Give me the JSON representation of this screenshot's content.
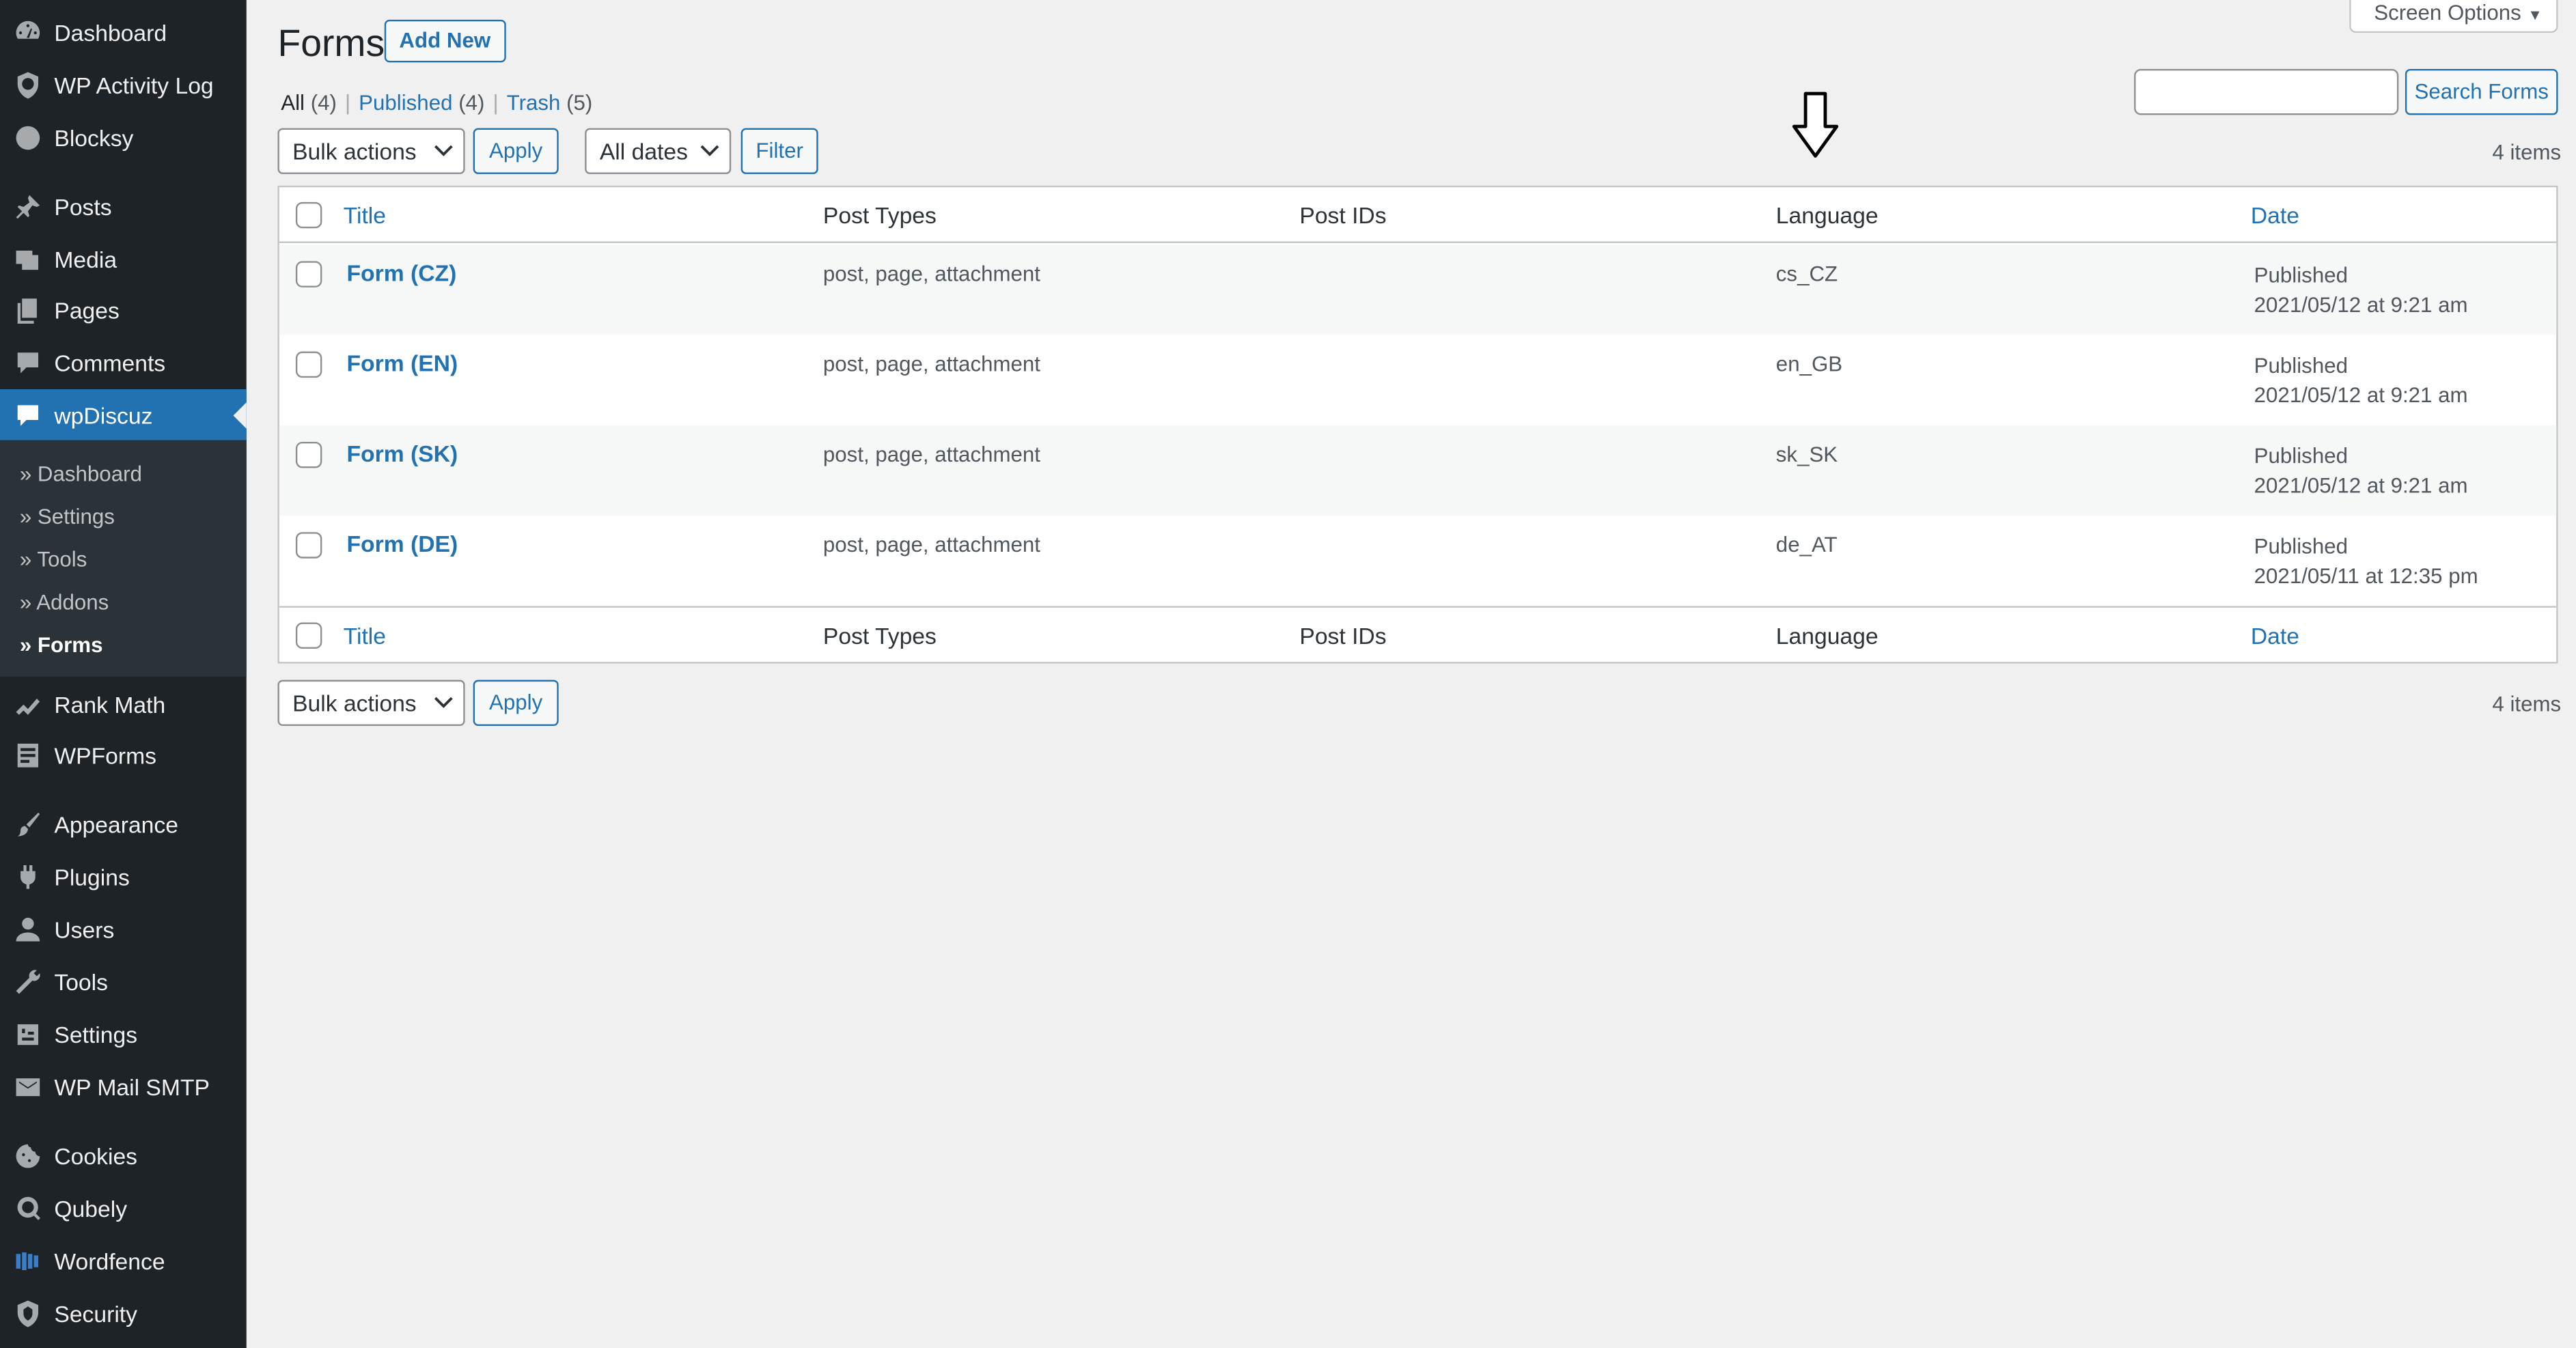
{
  "sidebar": {
    "items": [
      {
        "label": "Dashboard",
        "icon": "dashboard-icon"
      },
      {
        "label": "WP Activity Log",
        "icon": "activity-log-icon"
      },
      {
        "label": "Blocksy",
        "icon": "blocksy-icon"
      },
      {
        "label": "Posts",
        "icon": "pin-icon"
      },
      {
        "label": "Media",
        "icon": "media-icon"
      },
      {
        "label": "Pages",
        "icon": "pages-icon"
      },
      {
        "label": "Comments",
        "icon": "comment-icon"
      },
      {
        "label": "wpDiscuz",
        "icon": "comment-icon"
      },
      {
        "label": "Rank Math",
        "icon": "rank-math-icon"
      },
      {
        "label": "WPForms",
        "icon": "forms-icon"
      },
      {
        "label": "Appearance",
        "icon": "paintbrush-icon"
      },
      {
        "label": "Plugins",
        "icon": "plugin-icon"
      },
      {
        "label": "Users",
        "icon": "user-icon"
      },
      {
        "label": "Tools",
        "icon": "wrench-icon"
      },
      {
        "label": "Settings",
        "icon": "settings-icon"
      },
      {
        "label": "WP Mail SMTP",
        "icon": "mail-icon"
      },
      {
        "label": "Cookies",
        "icon": "cookie-icon"
      },
      {
        "label": "Qubely",
        "icon": "qubely-icon"
      },
      {
        "label": "Wordfence",
        "icon": "wordfence-icon"
      },
      {
        "label": "Security",
        "icon": "shield-icon"
      }
    ],
    "submenu": [
      {
        "label": "» Dashboard"
      },
      {
        "label": "» Settings"
      },
      {
        "label": "» Tools"
      },
      {
        "label": "» Addons"
      },
      {
        "label": "» Forms"
      }
    ]
  },
  "header": {
    "title": "Forms",
    "add_new": "Add New",
    "screen_options": "Screen Options"
  },
  "views": {
    "all": "All",
    "all_count": "(4)",
    "published": "Published",
    "published_count": "(4)",
    "trash": "Trash",
    "trash_count": "(5)",
    "sep": "|"
  },
  "search": {
    "button": "Search Forms",
    "value": ""
  },
  "toolbar": {
    "bulk_actions": "Bulk actions",
    "apply": "Apply",
    "all_dates": "All dates",
    "filter": "Filter",
    "items_count": "4 items"
  },
  "table": {
    "columns": [
      "Title",
      "Post Types",
      "Post IDs",
      "Language",
      "Date"
    ],
    "rows": [
      {
        "title": "Form (CZ)",
        "post_types": "post, page, attachment",
        "post_ids": "",
        "language": "cs_CZ",
        "status": "Published",
        "date": "2021/05/12 at 9:21 am"
      },
      {
        "title": "Form (EN)",
        "post_types": "post, page, attachment",
        "post_ids": "",
        "language": "en_GB",
        "status": "Published",
        "date": "2021/05/12 at 9:21 am"
      },
      {
        "title": "Form (SK)",
        "post_types": "post, page, attachment",
        "post_ids": "",
        "language": "sk_SK",
        "status": "Published",
        "date": "2021/05/12 at 9:21 am"
      },
      {
        "title": "Form (DE)",
        "post_types": "post, page, attachment",
        "post_ids": "",
        "language": "de_AT",
        "status": "Published",
        "date": "2021/05/11 at 12:35 pm"
      }
    ]
  },
  "colors": {
    "sidebar_bg": "#1d2327",
    "accent": "#2271b1",
    "page_bg": "#f0f0f1"
  }
}
